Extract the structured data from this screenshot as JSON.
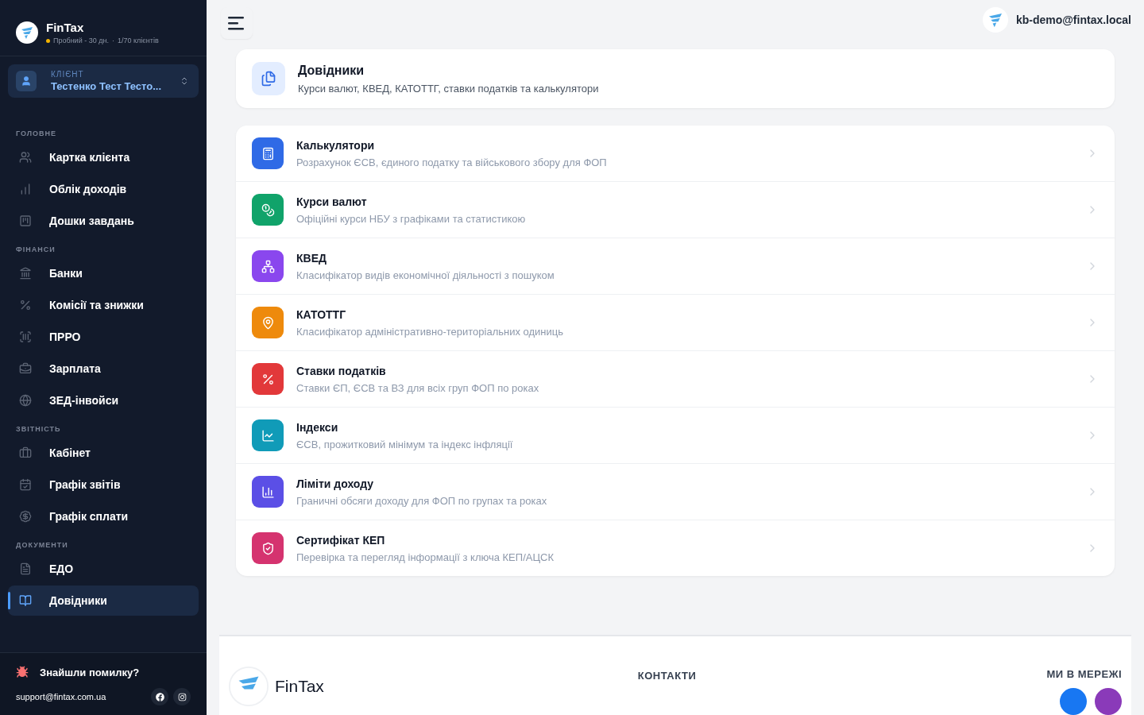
{
  "sidebar": {
    "brand": "FinTax",
    "plan": "Пробний - 30 дн.",
    "separator": "·",
    "clients": "1/70 клієнтів",
    "client": {
      "label": "КЛІЄНТ",
      "name": "Тестенко Тест Тесто..."
    },
    "sections": [
      {
        "title": "ГОЛОВНЕ",
        "items": [
          {
            "label": "Картка клієнта",
            "selected": false
          },
          {
            "label": "Облік доходів",
            "selected": false
          },
          {
            "label": "Дошки завдань",
            "selected": false
          }
        ]
      },
      {
        "title": "ФІНАНСИ",
        "items": [
          {
            "label": "Банки",
            "selected": false
          },
          {
            "label": "Комісії та знижки",
            "selected": false
          },
          {
            "label": "ПРРО",
            "selected": false
          },
          {
            "label": "Зарплата",
            "selected": false
          },
          {
            "label": "ЗЕД-інвойси",
            "selected": false
          }
        ]
      },
      {
        "title": "ЗВІТНІСТЬ",
        "items": [
          {
            "label": "Кабінет",
            "selected": false
          },
          {
            "label": "Графік звітів",
            "selected": false
          },
          {
            "label": "Графік сплати",
            "selected": false
          }
        ]
      },
      {
        "title": "ДОКУМЕНТИ",
        "items": [
          {
            "label": "ЕДО",
            "selected": false
          },
          {
            "label": "Довідники",
            "selected": true
          }
        ]
      }
    ],
    "bug_report": "Знайшли помилку?",
    "support_email": "support@fintax.com.ua"
  },
  "topbar": {
    "user": "kb-demo@fintax.local"
  },
  "header": {
    "title": "Довідники",
    "subtitle": "Курси валют, КВЕД, КАТОТТГ, ставки податків та калькулятори"
  },
  "items": [
    {
      "title": "Калькулятори",
      "description": "Розрахунок ЄСВ, єдиного податку та військового збору для ФОП",
      "color": "#2f6ae6"
    },
    {
      "title": "Курси валют",
      "description": "Офіційні курси НБУ з графіками та статистикою",
      "color": "#10a36a"
    },
    {
      "title": "КВЕД",
      "description": "Класифікатор видів економічної діяльності з пошуком",
      "color": "#8a47ee"
    },
    {
      "title": "КАТОТТГ",
      "description": "Класифікатор адміністративно-територіальних одиниць",
      "color": "#ee8a0c"
    },
    {
      "title": "Ставки податків",
      "description": "Ставки ЄП, ЄСВ та ВЗ для всіх груп ФОП по роках",
      "color": "#e2383a"
    },
    {
      "title": "Індекси",
      "description": "ЄСВ, прожитковий мінімум та індекс інфляції",
      "color": "#109bb8"
    },
    {
      "title": "Ліміти доходу",
      "description": "Граничні обсяги доходу для ФОП по групах та роках",
      "color": "#5b4fe6"
    },
    {
      "title": "Сертифікат КЕП",
      "description": "Перевірка та перегляд інформації з ключа КЕП/АЦСК",
      "color": "#d5336f"
    }
  ],
  "footer": {
    "brand": "FinTax",
    "contacts_title": "КОНТАКТИ",
    "social_title": "МИ В МЕРЕЖІ"
  }
}
